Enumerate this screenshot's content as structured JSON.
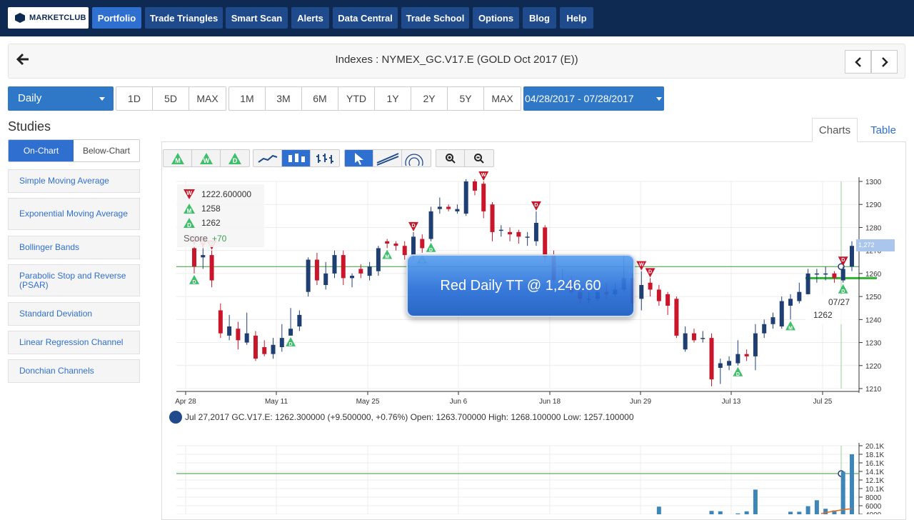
{
  "nav": {
    "logo": "MARKETCLUB",
    "items": [
      {
        "label": "Portfolio",
        "active": true
      },
      {
        "label": "Trade Triangles",
        "active": false
      },
      {
        "label": "Smart Scan",
        "active": false
      },
      {
        "label": "Alerts",
        "active": false
      },
      {
        "label": "Data Central",
        "active": false
      },
      {
        "label": "Trade School",
        "active": false
      },
      {
        "label": "Options",
        "active": false
      },
      {
        "label": "Blog",
        "active": false
      },
      {
        "label": "Help",
        "active": false
      }
    ]
  },
  "header": {
    "title": "Indexes : NYMEX_GC.V17.E (GOLD Oct 2017 (E))",
    "back_icon": "arrow-left-icon",
    "prev_icon": "chevron-left-icon",
    "next_icon": "chevron-right-icon"
  },
  "controls": {
    "period": "Daily",
    "intraday": [
      "1D",
      "5D",
      "MAX"
    ],
    "ranges": [
      "1M",
      "3M",
      "6M",
      "YTD",
      "1Y",
      "2Y",
      "5Y",
      "MAX"
    ],
    "date_range": "04/28/2017 - 07/28/2017"
  },
  "studies": {
    "title": "Studies",
    "tabs": [
      "On-Chart",
      "Below-Chart"
    ],
    "active_tab": "On-Chart",
    "items": [
      "Simple Moving Average",
      "Exponential Moving Average",
      "Bollinger Bands",
      "Parabolic Stop and Reverse (PSAR)",
      "Standard Deviation",
      "Linear Regression Channel",
      "Donchian Channels"
    ]
  },
  "chart_tabs": {
    "charts": "Charts",
    "table": "Table",
    "active": "Charts"
  },
  "toolbar": {
    "triangles": [
      "M",
      "W",
      "D"
    ],
    "chart_types": [
      "line",
      "bars",
      "candles"
    ],
    "tools": [
      "pointer",
      "trendline",
      "fibonacci"
    ],
    "zoom": [
      "zoom-in",
      "zoom-out"
    ]
  },
  "legend": {
    "entries": [
      {
        "type": "red-down",
        "letter": "W",
        "value": "1222.600000"
      },
      {
        "type": "green-up",
        "letter": "M",
        "value": "1258"
      },
      {
        "type": "green-up",
        "letter": "D",
        "value": "1262"
      }
    ],
    "score_label": "Score",
    "score_value": "+70"
  },
  "banner": "Red Daily TT @ 1,246.60",
  "tooltip": {
    "date": "07/27",
    "value": "1262"
  },
  "price_tag": "1,272",
  "ohlc": "Jul 27,2017 GC.V17.E: 1262.300000 (+9.500000, +0.76%) Open: 1263.700000 High: 1268.100000 Low: 1257.100000",
  "chart_data": [
    {
      "type": "candlestick",
      "x_ticks": [
        "Apr 28",
        "May 11",
        "May 25",
        "Jun 6",
        "Jun 18",
        "Jun 29",
        "Jul 13",
        "Jul 25"
      ],
      "y_ticks": [
        "1300",
        "1290",
        "1280",
        "1270",
        "1260",
        "1250",
        "1240",
        "1230",
        "1220",
        "1210"
      ],
      "ylim": [
        1210,
        1300
      ],
      "colors": {
        "up": "#1f3f73",
        "down": "#c9162a",
        "line": "#3a9a3a"
      },
      "horizontal_lines": [
        1263,
        1258
      ],
      "candles": [
        {
          "o": 1271,
          "c": 1263,
          "h": 1272,
          "l": 1260
        },
        {
          "o": 1267,
          "c": 1268,
          "h": 1271,
          "l": 1262
        },
        {
          "o": 1268,
          "c": 1257,
          "h": 1270,
          "l": 1254
        },
        {
          "o": 1244,
          "c": 1234,
          "h": 1247,
          "l": 1232
        },
        {
          "o": 1233,
          "c": 1237,
          "h": 1242,
          "l": 1231
        },
        {
          "o": 1236,
          "c": 1231,
          "h": 1239,
          "l": 1227
        },
        {
          "o": 1230,
          "c": 1234,
          "h": 1243,
          "l": 1229
        },
        {
          "o": 1233,
          "c": 1223,
          "h": 1235,
          "l": 1222
        },
        {
          "o": 1228,
          "c": 1225,
          "h": 1231,
          "l": 1224
        },
        {
          "o": 1225,
          "c": 1229,
          "h": 1232,
          "l": 1223
        },
        {
          "o": 1228,
          "c": 1232,
          "h": 1238,
          "l": 1226
        },
        {
          "o": 1233,
          "c": 1236,
          "h": 1245,
          "l": 1233
        },
        {
          "o": 1237,
          "c": 1242,
          "h": 1244,
          "l": 1235
        },
        {
          "o": 1252,
          "c": 1266,
          "h": 1267,
          "l": 1250
        },
        {
          "o": 1266,
          "c": 1257,
          "h": 1269,
          "l": 1255
        },
        {
          "o": 1255,
          "c": 1260,
          "h": 1265,
          "l": 1253
        },
        {
          "o": 1260,
          "c": 1268,
          "h": 1270,
          "l": 1258
        },
        {
          "o": 1268,
          "c": 1258,
          "h": 1270,
          "l": 1255
        },
        {
          "o": 1258,
          "c": 1259,
          "h": 1260,
          "l": 1254
        },
        {
          "o": 1262,
          "c": 1260,
          "h": 1264,
          "l": 1258
        },
        {
          "o": 1259,
          "c": 1263,
          "h": 1265,
          "l": 1257
        },
        {
          "o": 1261,
          "c": 1271,
          "h": 1272,
          "l": 1259
        },
        {
          "o": 1274,
          "c": 1273,
          "h": 1275,
          "l": 1271
        },
        {
          "o": 1273,
          "c": 1272,
          "h": 1274,
          "l": 1270
        },
        {
          "o": 1272,
          "c": 1268,
          "h": 1274,
          "l": 1266
        },
        {
          "o": 1268,
          "c": 1276,
          "h": 1278,
          "l": 1266
        },
        {
          "o": 1275,
          "c": 1271,
          "h": 1277,
          "l": 1269
        },
        {
          "o": 1275,
          "c": 1287,
          "h": 1289,
          "l": 1274
        },
        {
          "o": 1288,
          "c": 1289,
          "h": 1293,
          "l": 1286
        },
        {
          "o": 1289,
          "c": 1288,
          "h": 1290,
          "l": 1287
        },
        {
          "o": 1287,
          "c": 1288,
          "h": 1290,
          "l": 1286
        },
        {
          "o": 1286,
          "c": 1300,
          "h": 1301,
          "l": 1285
        },
        {
          "o": 1300,
          "c": 1296,
          "h": 1301,
          "l": 1294
        },
        {
          "o": 1299,
          "c": 1287,
          "h": 1300,
          "l": 1284
        },
        {
          "o": 1290,
          "c": 1278,
          "h": 1291,
          "l": 1274
        },
        {
          "o": 1279,
          "c": 1279,
          "h": 1281,
          "l": 1276
        },
        {
          "o": 1278,
          "c": 1277,
          "h": 1280,
          "l": 1274
        },
        {
          "o": 1278,
          "c": 1276,
          "h": 1279,
          "l": 1273
        },
        {
          "o": 1276,
          "c": 1276,
          "h": 1278,
          "l": 1272
        },
        {
          "o": 1274,
          "c": 1282,
          "h": 1287,
          "l": 1272
        },
        {
          "o": 1280,
          "c": 1267,
          "h": 1281,
          "l": 1265
        },
        {
          "o": 1268,
          "c": 1257,
          "h": 1270,
          "l": 1256
        },
        {
          "o": 1257,
          "c": 1257,
          "h": 1262,
          "l": 1256
        },
        {
          "o": 1257,
          "c": 1252,
          "h": 1259,
          "l": 1251
        },
        {
          "o": 1252,
          "c": 1249,
          "h": 1254,
          "l": 1247
        },
        {
          "o": 1249,
          "c": 1249,
          "h": 1252,
          "l": 1247
        },
        {
          "o": 1249,
          "c": 1252,
          "h": 1256,
          "l": 1248
        },
        {
          "o": 1252,
          "c": 1251,
          "h": 1256,
          "l": 1249
        },
        {
          "o": 1251,
          "c": 1253,
          "h": 1256,
          "l": 1250
        },
        {
          "o": 1253,
          "c": 1258,
          "h": 1268,
          "l": 1252
        },
        {
          "o": 1258,
          "c": 1247,
          "h": 1260,
          "l": 1245
        },
        {
          "o": 1249,
          "c": 1255,
          "h": 1261,
          "l": 1244
        },
        {
          "o": 1256,
          "c": 1253,
          "h": 1258,
          "l": 1250
        },
        {
          "o": 1253,
          "c": 1248,
          "h": 1255,
          "l": 1246
        },
        {
          "o": 1251,
          "c": 1246,
          "h": 1252,
          "l": 1242
        },
        {
          "o": 1249,
          "c": 1233,
          "h": 1250,
          "l": 1232
        },
        {
          "o": 1227,
          "c": 1234,
          "h": 1237,
          "l": 1226
        },
        {
          "o": 1234,
          "c": 1231,
          "h": 1236,
          "l": 1230
        },
        {
          "o": 1232,
          "c": 1232,
          "h": 1235,
          "l": 1230
        },
        {
          "o": 1232,
          "c": 1214,
          "h": 1234,
          "l": 1211
        },
        {
          "o": 1219,
          "c": 1221,
          "h": 1223,
          "l": 1212
        },
        {
          "o": 1220,
          "c": 1222,
          "h": 1224,
          "l": 1218
        },
        {
          "o": 1221,
          "c": 1225,
          "h": 1231,
          "l": 1220
        },
        {
          "o": 1225,
          "c": 1224,
          "h": 1227,
          "l": 1222
        },
        {
          "o": 1224,
          "c": 1234,
          "h": 1238,
          "l": 1218
        },
        {
          "o": 1234,
          "c": 1238,
          "h": 1240,
          "l": 1232
        },
        {
          "o": 1238,
          "c": 1241,
          "h": 1243,
          "l": 1236
        },
        {
          "o": 1237,
          "c": 1248,
          "h": 1250,
          "l": 1236
        },
        {
          "o": 1246,
          "c": 1249,
          "h": 1251,
          "l": 1240
        },
        {
          "o": 1248,
          "c": 1252,
          "h": 1256,
          "l": 1247
        },
        {
          "o": 1251,
          "c": 1260,
          "h": 1262,
          "l": 1250
        },
        {
          "o": 1260,
          "c": 1260,
          "h": 1262,
          "l": 1256
        },
        {
          "o": 1260,
          "c": 1260,
          "h": 1263,
          "l": 1257
        },
        {
          "o": 1260,
          "c": 1258,
          "h": 1261,
          "l": 1256
        },
        {
          "o": 1257,
          "c": 1262,
          "h": 1263,
          "l": 1256
        },
        {
          "o": 1263,
          "c": 1272,
          "h": 1274,
          "l": 1261
        }
      ],
      "signals": [
        {
          "i": 0,
          "type": "down",
          "letter": "W"
        },
        {
          "i": 1,
          "type": "down",
          "letter": "D"
        },
        {
          "i": 2,
          "type": "down",
          "letter": "W"
        },
        {
          "i": 0,
          "type": "up",
          "letter": "D"
        },
        {
          "i": 11,
          "type": "up",
          "letter": "D"
        },
        {
          "i": 22,
          "type": "up",
          "letter": "M"
        },
        {
          "i": 25,
          "type": "down",
          "letter": "D"
        },
        {
          "i": 26,
          "type": "up",
          "letter": "W"
        },
        {
          "i": 27,
          "type": "up",
          "letter": "D"
        },
        {
          "i": 33,
          "type": "down",
          "letter": "W"
        },
        {
          "i": 39,
          "type": "down",
          "letter": "D"
        },
        {
          "i": 51,
          "type": "down",
          "letter": "W"
        },
        {
          "i": 52,
          "type": "down",
          "letter": "D"
        },
        {
          "i": 62,
          "type": "up",
          "letter": "D"
        },
        {
          "i": 68,
          "type": "up",
          "letter": "M"
        },
        {
          "i": 74,
          "type": "down",
          "letter": "D"
        },
        {
          "i": 74,
          "type": "up",
          "letter": "D"
        }
      ]
    },
    {
      "type": "bar",
      "series": "volume",
      "y_ticks": [
        "20.1K",
        "18.1K",
        "16.1K",
        "14.1K",
        "12.1K",
        "10.1K",
        "8000",
        "6000",
        "4000"
      ],
      "ylim": [
        4000,
        20100
      ],
      "values": [
        5800,
        0,
        0,
        0,
        0,
        0,
        4800,
        4700,
        0,
        4200,
        4700,
        9800,
        0,
        0,
        0,
        4600,
        4600,
        5900,
        7300,
        5300,
        4900,
        14000,
        18100
      ]
    }
  ]
}
